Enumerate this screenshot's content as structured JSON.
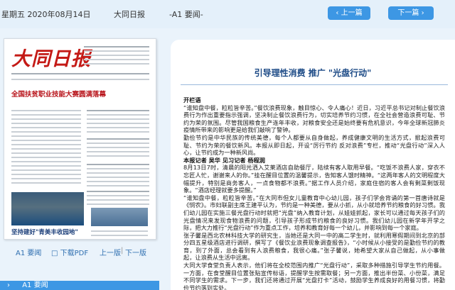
{
  "header": {
    "date": "星期五 2020年08月14日",
    "paper_name": "大同日报",
    "page_label": "-A1 要闻-",
    "prev_button": "上一篇",
    "next_button": "下一篇"
  },
  "thumbnail": {
    "masthead": "大同日报",
    "headline_1": "全国扶贫职业技能大赛圆满落幕",
    "headline_2": "坚持建好\"青美丰收园地\""
  },
  "page_nav": {
    "page": "A1 要闻",
    "download": "下载PDF",
    "prev_page": "上一版",
    "next_page": "下一版"
  },
  "section_bar": {
    "label": "A1 要闻"
  },
  "article": {
    "title": "引导理性消费 推广 \"光盘行动\"",
    "lead_heading": "开栏语",
    "paragraphs": [
      "“谁知盘中餐，粒粒皆辛苦。”餐饮浪费现象，触目惊心、令人痛心！近日，习近平总书记对制止餐饮浪费行为作出重要指示强调，坚决制止餐饮浪费行为，切实培养节约习惯，在全社会营造浪费可耻、节约为荣的氛围。尽管我国粮食生产连年丰收，对粮食安全还是始终要有危机意识，今年全球新冠肺炎疫情所带来的影响更是给我们敲响了警钟。",
      "勤俭节约是中华民族的传统美德，每个人都要从自身做起，养成健康文明的生活方式，掀起浪费可耻、节约为荣的餐饮新风。本报从即日起，开设“厉行节约 反对浪费”专栏，推动“光盘行动”深入人心，让节约成为一种新风尚。"
    ],
    "byline": "本报记者 吴华 见习记者 杨程润",
    "paragraphs_2": [
      "8月13日7时，清晨的阳光洒入艾莱酒店自助餐厅，陆续有客人取用早餐。“吃饭不浪费人家，穿衣不忘匠人忙，谢谢来人的你。”挂在醒目位置的温馨提示，告知客人饿时精神。“这两年客人的文明程度大幅提升，特别是商务客人，一点食物都不浪费。”据工作人员介绍，家庭住宿的客人会有剩菜剩饭现象。“酒店经理就要多提醒。”",
      "“谁知盘中餐，粒粒皆辛苦。”在大同市但女儿童教育中心幼儿园，孩子们学会背诵的第一首唐诗就是《悯农》。市妇联副主席王建平认为，节约是一种美德，要从小抓，从小就培养节约粮食的好习惯。我们幼儿园在实施三餐光盘行动时就把“光盘”纳入教育计划，从娃娃抓起，家长可以通过每天孩子们的光盘情况来发现食物浪费的问题，引导孩子形成节约粮食的良好习惯。我们幼儿园在新学年开学之际，把大力推行“光盘行动”作为重点工作，培养和教育好每一个幼儿，并影响到每一个家庭。",
      "张子馨是西北农林科技大学的研究生，当她还是大同一中的高二学生时，就利用寒假期间到北京的部分四五星级酒店进行调研，撰写了《餐饮业浪费现象调查报告》，“小时候从小接受的是勤俭节约的教育，到了外面，总会看到有人浪费粮食，我很心痛。”张子馨说，她希望大家从自己做起，从小事做起，让浪费从生活中远离。",
      "大同大学食堂负责人表示，他们将在全校范围内推广“光盘行动”，采取多种措施引导学生节约用餐。一方面，在食堂醒目位置张贴宣传标语，提醒学生按需取餐；另一方面，推出半份菜、小份菜，满足不同学生的需求。下一步，我们还将通过开展“光盘打卡”活动，鼓励学生养成良好的用餐习惯，将勤俭节约落到实处。"
    ]
  },
  "colors": {
    "accent": "#3d97e4",
    "title": "#1c4a86",
    "masthead": "#c41a16"
  }
}
